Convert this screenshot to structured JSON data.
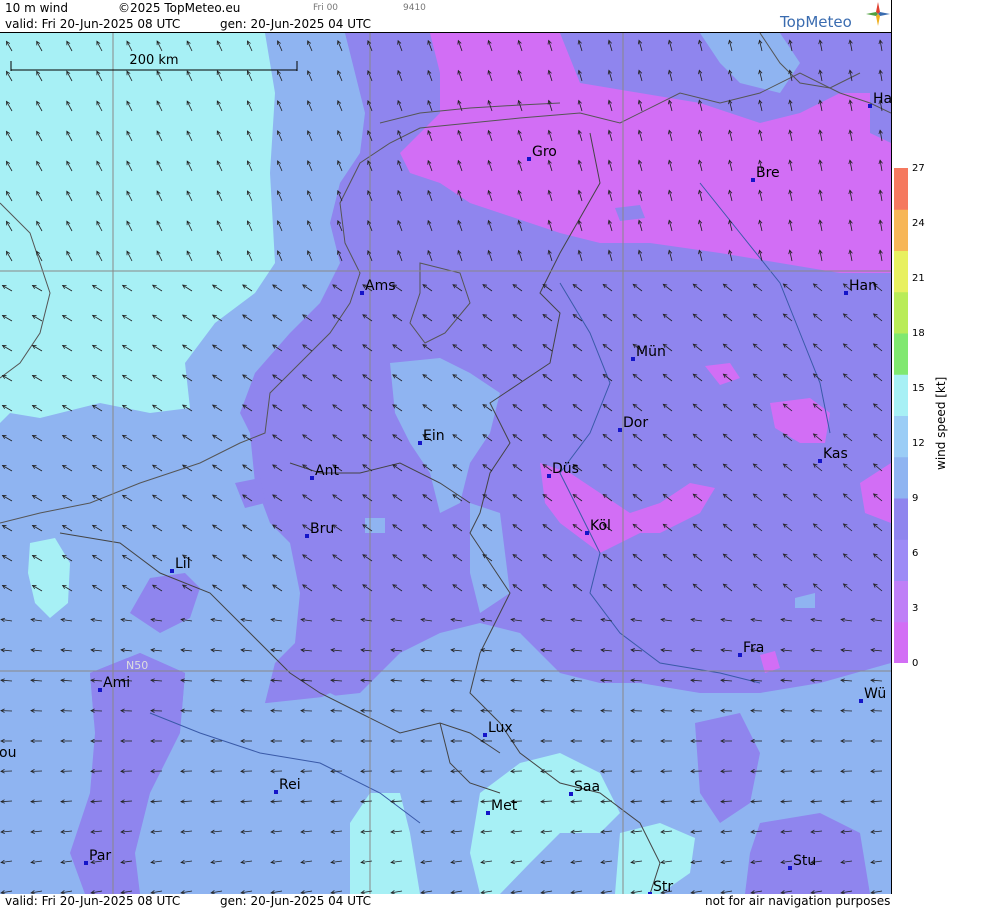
{
  "header": {
    "product": "10 m wind",
    "copyright": "©2025 TopMeteo.eu",
    "run_label": "Fri 00",
    "run_code": "9410",
    "valid": "valid:  Fri  20-Jun-2025  08 UTC",
    "generated": "gen: 20-Jun-2025 04 UTC"
  },
  "logo": {
    "text": "TopMeteo",
    "icon": "compass-star-icon"
  },
  "scale_bar": {
    "label": "200 km"
  },
  "grid_label": "N50",
  "footer": {
    "valid": "valid:  Fri  20-Jun-2025  08 UTC",
    "generated": "gen: 20-Jun-2025 04 UTC",
    "disclaimer": "not for air navigation purposes"
  },
  "colorbar": {
    "title": "wind  speed  [kt]",
    "ticks": [
      "27",
      "24",
      "21",
      "18",
      "15",
      "12",
      "9",
      "6",
      "3",
      "0"
    ],
    "colors": [
      "#d26ef5",
      "#bf7ff7",
      "#9d8af6",
      "#8f85ee",
      "#8fb4f1",
      "#9bcdf6",
      "#a7f0f5",
      "#80e870",
      "#b9ec58",
      "#e8f060",
      "#f7b657",
      "#f5795f"
    ]
  },
  "cities": [
    {
      "name": "Ha"
    },
    {
      "name": "Gro"
    },
    {
      "name": "Bre"
    },
    {
      "name": "Ams"
    },
    {
      "name": "Han"
    },
    {
      "name": "Mün"
    },
    {
      "name": "Dor"
    },
    {
      "name": "Ein"
    },
    {
      "name": "Kas"
    },
    {
      "name": "Ant"
    },
    {
      "name": "Düs"
    },
    {
      "name": "Bru"
    },
    {
      "name": "Köl"
    },
    {
      "name": "Lil"
    },
    {
      "name": "Fra"
    },
    {
      "name": "Ami"
    },
    {
      "name": "Wü"
    },
    {
      "name": "ou"
    },
    {
      "name": "Lux"
    },
    {
      "name": "Rei"
    },
    {
      "name": "Saa"
    },
    {
      "name": "Met"
    },
    {
      "name": "Par"
    },
    {
      "name": "Stu"
    },
    {
      "name": "Str"
    }
  ]
}
